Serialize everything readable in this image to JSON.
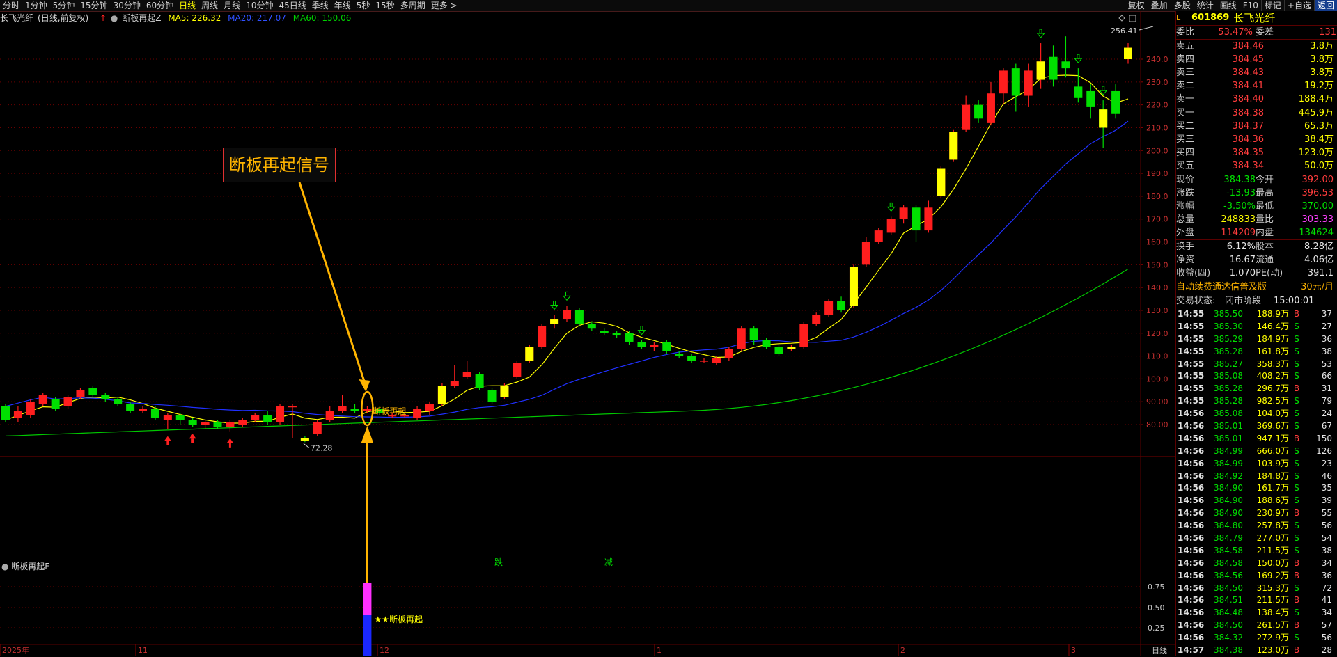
{
  "toolbar": {
    "periods": [
      "分时",
      "1分钟",
      "5分钟",
      "15分钟",
      "30分钟",
      "60分钟",
      "日线",
      "周线",
      "月线",
      "10分钟",
      "45日线",
      "季线",
      "年线",
      "5秒",
      "15秒",
      "多周期",
      "更多 >"
    ],
    "active_period": "日线",
    "right_buttons": [
      "复权",
      "叠加",
      "多股",
      "统计",
      "画线",
      "F10",
      "标记",
      "+自选",
      "返回"
    ]
  },
  "legend": {
    "stock_name": "长飞光纤",
    "mode": "(日线,前复权)",
    "indicator": "断板再起Z",
    "ma5": "MA5: 226.32",
    "ma20": "MA20: 217.07",
    "ma60": "MA60: 150.06"
  },
  "annotation": {
    "box_text": "断板再起信号",
    "signal_label": "断板再起",
    "low_label": "72.28",
    "high_label": "256.41",
    "marker_die": "跌",
    "marker_jian": "减"
  },
  "sub_panel": {
    "title": "断板再起F",
    "signal_label": "★★断板再起",
    "ticks": [
      "0.75",
      "0.50",
      "0.25"
    ]
  },
  "x_axis": {
    "labels": [
      "2025年",
      "11",
      "12",
      "1",
      "2",
      "3"
    ],
    "period_label": "日线"
  },
  "price_axis": {
    "ticks": [
      "240.0",
      "230.0",
      "220.0",
      "210.0",
      "200.0",
      "190.0",
      "180.0",
      "170.0",
      "160.0",
      "150.0",
      "140.0",
      "130.0",
      "120.0",
      "110.0",
      "100.0",
      "90.00",
      "80.00"
    ]
  },
  "quote": {
    "code": "601869",
    "name": "长飞光纤",
    "weibi_label": "委比",
    "weibi": "53.47%",
    "weicha_label": "委差",
    "weicha": "131",
    "asks": [
      {
        "label": "卖五",
        "price": "384.46",
        "vol": "3.8万"
      },
      {
        "label": "卖四",
        "price": "384.45",
        "vol": "3.8万"
      },
      {
        "label": "卖三",
        "price": "384.43",
        "vol": "3.8万"
      },
      {
        "label": "卖二",
        "price": "384.41",
        "vol": "19.2万"
      },
      {
        "label": "卖一",
        "price": "384.40",
        "vol": "188.4万"
      }
    ],
    "bids": [
      {
        "label": "买一",
        "price": "384.38",
        "vol": "445.9万"
      },
      {
        "label": "买二",
        "price": "384.37",
        "vol": "65.3万"
      },
      {
        "label": "买三",
        "price": "384.36",
        "vol": "38.4万"
      },
      {
        "label": "买四",
        "price": "384.35",
        "vol": "123.0万"
      },
      {
        "label": "买五",
        "price": "384.34",
        "vol": "50.0万"
      }
    ],
    "stats": [
      {
        "l1": "现价",
        "v1": "384.38",
        "l2": "今开",
        "v2": "392.00",
        "c1": "green",
        "c2": "red"
      },
      {
        "l1": "涨跌",
        "v1": "-13.93",
        "l2": "最高",
        "v2": "396.53",
        "c1": "green",
        "c2": "red"
      },
      {
        "l1": "涨幅",
        "v1": "-3.50%",
        "l2": "最低",
        "v2": "370.00",
        "c1": "green",
        "c2": "green"
      },
      {
        "l1": "总量",
        "v1": "248833",
        "l2": "量比",
        "v2": "303.33",
        "c1": "yellow",
        "c2": "magenta"
      },
      {
        "l1": "外盘",
        "v1": "114209",
        "l2": "内盘",
        "v2": "134624",
        "c1": "red",
        "c2": "green"
      }
    ],
    "finance": [
      {
        "l1": "换手",
        "v1": "6.12%",
        "l2": "股本",
        "v2": "8.28亿"
      },
      {
        "l1": "净资",
        "v1": "16.67",
        "l2": "流通",
        "v2": "4.06亿"
      },
      {
        "l1": "收益(四)",
        "v1": "1.070",
        "l2": "PE(动)",
        "v2": "391.1"
      }
    ],
    "promo": "自动续费通达信普及版",
    "promo_price": "30元/月",
    "status_label": "交易状态:",
    "status": "闭市阶段",
    "status_time": "15:00:01"
  },
  "trades": [
    {
      "t": "14:55",
      "p": "385.50",
      "v": "188.9万",
      "bs": "B",
      "n": "37"
    },
    {
      "t": "14:55",
      "p": "385.30",
      "v": "146.4万",
      "bs": "S",
      "n": "27"
    },
    {
      "t": "14:55",
      "p": "385.29",
      "v": "184.9万",
      "bs": "S",
      "n": "36"
    },
    {
      "t": "14:55",
      "p": "385.28",
      "v": "161.8万",
      "bs": "S",
      "n": "38"
    },
    {
      "t": "14:55",
      "p": "385.27",
      "v": "358.3万",
      "bs": "S",
      "n": "53"
    },
    {
      "t": "14:55",
      "p": "385.08",
      "v": "408.2万",
      "bs": "S",
      "n": "66"
    },
    {
      "t": "14:55",
      "p": "385.28",
      "v": "296.7万",
      "bs": "B",
      "n": "31"
    },
    {
      "t": "14:55",
      "p": "385.28",
      "v": "982.5万",
      "bs": "S",
      "n": "79"
    },
    {
      "t": "14:56",
      "p": "385.08",
      "v": "104.0万",
      "bs": "S",
      "n": "24"
    },
    {
      "t": "14:56",
      "p": "385.01",
      "v": "369.6万",
      "bs": "S",
      "n": "67"
    },
    {
      "t": "14:56",
      "p": "385.01",
      "v": "947.1万",
      "bs": "B",
      "n": "150"
    },
    {
      "t": "14:56",
      "p": "384.99",
      "v": "666.0万",
      "bs": "S",
      "n": "126"
    },
    {
      "t": "14:56",
      "p": "384.99",
      "v": "103.9万",
      "bs": "S",
      "n": "23"
    },
    {
      "t": "14:56",
      "p": "384.92",
      "v": "184.8万",
      "bs": "S",
      "n": "46"
    },
    {
      "t": "14:56",
      "p": "384.90",
      "v": "161.7万",
      "bs": "S",
      "n": "35"
    },
    {
      "t": "14:56",
      "p": "384.90",
      "v": "188.6万",
      "bs": "S",
      "n": "39"
    },
    {
      "t": "14:56",
      "p": "384.90",
      "v": "230.9万",
      "bs": "B",
      "n": "55"
    },
    {
      "t": "14:56",
      "p": "384.80",
      "v": "257.8万",
      "bs": "S",
      "n": "56"
    },
    {
      "t": "14:56",
      "p": "384.79",
      "v": "277.0万",
      "bs": "S",
      "n": "54"
    },
    {
      "t": "14:56",
      "p": "384.58",
      "v": "211.5万",
      "bs": "S",
      "n": "38"
    },
    {
      "t": "14:56",
      "p": "384.58",
      "v": "150.0万",
      "bs": "B",
      "n": "34"
    },
    {
      "t": "14:56",
      "p": "384.56",
      "v": "169.2万",
      "bs": "B",
      "n": "36"
    },
    {
      "t": "14:56",
      "p": "384.50",
      "v": "315.3万",
      "bs": "S",
      "n": "72"
    },
    {
      "t": "14:56",
      "p": "384.51",
      "v": "211.5万",
      "bs": "B",
      "n": "41"
    },
    {
      "t": "14:56",
      "p": "384.48",
      "v": "138.4万",
      "bs": "S",
      "n": "34"
    },
    {
      "t": "14:56",
      "p": "384.50",
      "v": "261.5万",
      "bs": "B",
      "n": "57"
    },
    {
      "t": "14:56",
      "p": "384.32",
      "v": "272.9万",
      "bs": "S",
      "n": "56"
    },
    {
      "t": "14:57",
      "p": "384.38",
      "v": "123.0万",
      "bs": "B",
      "n": "28"
    }
  ],
  "chart_data": {
    "type": "candlestick",
    "ylim": [
      67,
      262
    ],
    "ticks": [
      80,
      90,
      100,
      110,
      120,
      130,
      140,
      150,
      160,
      170,
      180,
      190,
      200,
      210,
      220,
      230,
      240
    ],
    "colors": {
      "up": "#ff1e1e",
      "down": "#00e000",
      "ma5": "#ffff00",
      "ma20": "#2030ff",
      "ma60": "#00c800",
      "signal": "#ffff00"
    },
    "candles": [
      [
        88,
        82,
        89,
        81
      ],
      [
        83,
        86,
        88,
        81
      ],
      [
        84,
        90,
        91,
        83
      ],
      [
        89,
        93,
        94,
        88
      ],
      [
        91,
        87,
        92,
        86
      ],
      [
        88,
        92,
        93,
        87
      ],
      [
        92,
        95,
        96,
        91
      ],
      [
        96,
        93,
        97,
        92
      ],
      [
        93,
        91,
        94,
        90
      ],
      [
        91,
        89,
        92,
        88
      ],
      [
        89,
        86,
        90,
        85
      ],
      [
        86,
        87,
        88,
        85
      ],
      [
        87,
        83,
        88,
        82
      ],
      [
        82,
        84,
        85,
        78
      ],
      [
        84,
        82,
        85,
        80
      ],
      [
        82,
        80,
        83,
        79
      ],
      [
        80,
        81,
        82,
        78
      ],
      [
        81,
        79,
        82,
        78
      ],
      [
        79,
        81,
        82,
        77
      ],
      [
        80,
        82,
        83,
        79
      ],
      [
        82,
        84,
        85,
        81
      ],
      [
        84,
        81,
        86,
        80
      ],
      [
        81,
        88,
        89,
        80
      ],
      [
        88,
        88,
        89,
        74
      ],
      [
        74,
        73,
        75,
        72.28
      ],
      [
        76,
        81,
        82,
        75
      ],
      [
        82,
        86,
        88,
        81
      ],
      [
        86,
        88,
        93,
        85
      ],
      [
        87,
        86,
        89,
        85
      ],
      [
        86,
        87,
        88,
        85
      ],
      [
        87,
        85,
        88,
        84
      ],
      [
        84,
        84,
        85,
        83
      ],
      [
        84,
        84,
        85,
        83
      ],
      [
        83,
        87,
        88,
        82
      ],
      [
        86,
        89,
        90,
        84
      ],
      [
        89,
        97,
        98,
        88
      ],
      [
        97,
        99,
        106,
        96
      ],
      [
        101,
        103,
        108,
        100
      ],
      [
        102,
        96,
        103,
        95
      ],
      [
        95,
        90,
        96,
        89
      ],
      [
        92,
        97,
        98,
        91
      ],
      [
        101,
        107,
        108,
        100
      ],
      [
        108,
        114,
        115,
        107
      ],
      [
        114,
        123,
        124,
        113
      ],
      [
        124,
        126,
        128,
        122
      ],
      [
        126,
        130,
        132,
        125
      ],
      [
        130,
        124,
        131,
        123
      ],
      [
        124,
        122,
        125,
        121
      ],
      [
        121,
        120,
        122,
        119
      ],
      [
        120,
        119,
        121,
        118
      ],
      [
        120,
        116,
        121,
        115
      ],
      [
        116,
        114,
        117,
        113
      ],
      [
        114,
        115,
        116,
        112
      ],
      [
        116,
        112,
        117,
        111
      ],
      [
        111,
        110,
        112,
        109
      ],
      [
        110,
        108,
        111,
        107
      ],
      [
        108,
        108,
        109,
        107
      ],
      [
        107,
        109,
        110,
        106
      ],
      [
        109,
        113,
        114,
        108
      ],
      [
        113,
        122,
        123,
        112
      ],
      [
        122,
        117,
        123,
        115
      ],
      [
        117,
        114,
        118,
        113
      ],
      [
        114,
        111,
        115,
        110
      ],
      [
        113,
        114,
        115,
        112
      ],
      [
        114,
        124,
        125,
        113
      ],
      [
        124,
        128,
        129,
        123
      ],
      [
        128,
        134,
        135,
        127
      ],
      [
        134,
        130,
        136,
        129
      ],
      [
        132,
        149,
        150,
        131
      ],
      [
        150,
        160,
        162,
        149
      ],
      [
        160,
        165,
        166,
        159
      ],
      [
        164,
        170,
        171,
        163
      ],
      [
        170,
        175,
        176,
        168
      ],
      [
        175,
        165,
        176,
        160
      ],
      [
        165,
        175,
        178,
        164
      ],
      [
        180,
        192,
        193,
        179
      ],
      [
        196,
        208,
        209,
        195
      ],
      [
        209,
        220,
        224,
        208
      ],
      [
        220,
        214,
        222,
        212
      ],
      [
        212,
        225,
        230,
        211
      ],
      [
        225,
        235,
        236,
        220
      ],
      [
        236,
        224,
        238,
        217
      ],
      [
        224,
        235,
        238,
        219
      ],
      [
        231,
        239,
        247,
        227
      ],
      [
        241,
        231,
        246,
        228
      ],
      [
        239,
        236,
        250,
        232
      ],
      [
        228,
        223,
        236,
        221
      ],
      [
        226,
        219,
        229,
        214
      ],
      [
        218,
        210,
        222,
        201
      ],
      [
        226,
        216,
        229,
        214
      ],
      [
        240,
        245,
        247,
        238
      ]
    ],
    "ma5_start": 0
  }
}
